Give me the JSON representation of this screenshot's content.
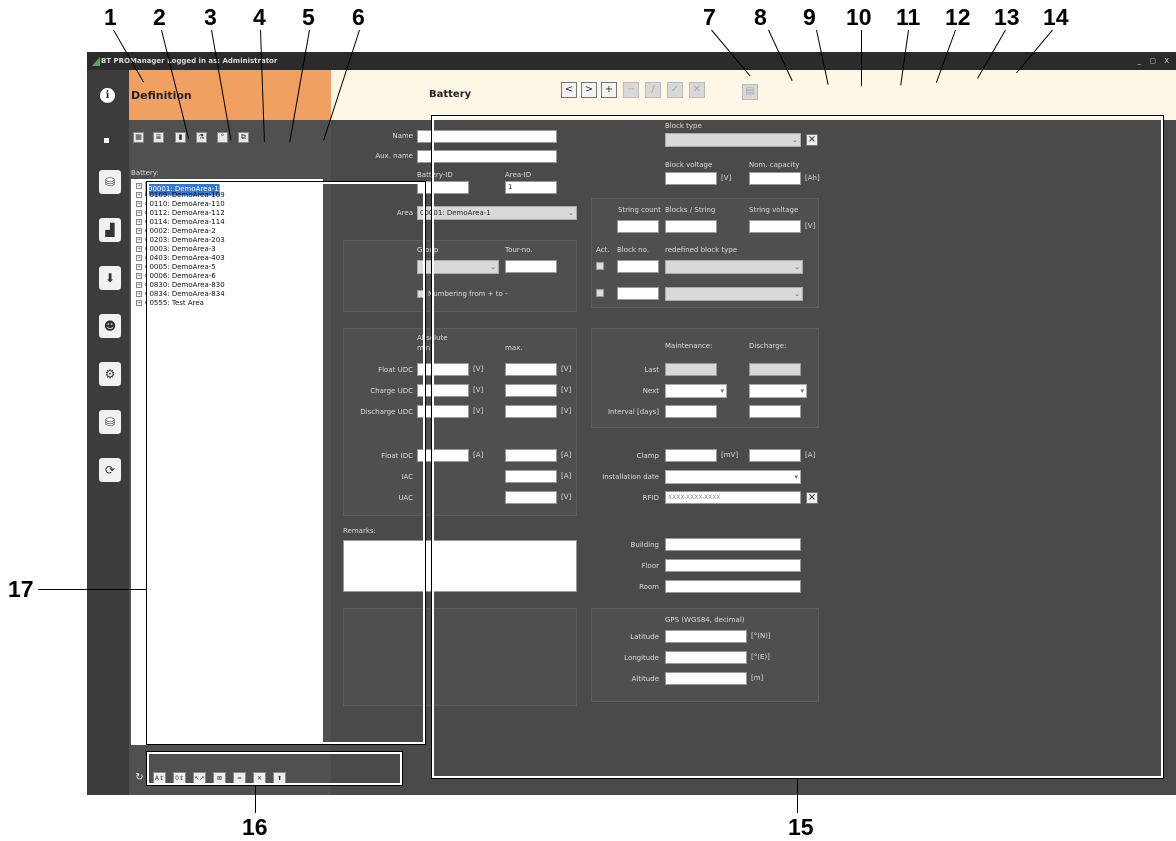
{
  "callouts": [
    "1",
    "2",
    "3",
    "4",
    "5",
    "6",
    "7",
    "8",
    "9",
    "10",
    "11",
    "12",
    "13",
    "14",
    "15",
    "16",
    "17"
  ],
  "window": {
    "app_name": "BT PRO",
    "title_text": "BT PROManager   Logged in as: Administrator",
    "controls": "_ ▢ X"
  },
  "info_icon": "i",
  "definition_tab": "Definition",
  "page_title": "Battery",
  "nav_buttons": [
    {
      "label": "<",
      "icon": "prev-icon",
      "enabled": true
    },
    {
      "label": ">",
      "icon": "next-icon",
      "enabled": true
    },
    {
      "label": "+",
      "icon": "add-icon",
      "enabled": true
    },
    {
      "label": "−",
      "icon": "delete-icon",
      "enabled": false
    },
    {
      "label": "/",
      "icon": "edit-icon",
      "enabled": false
    },
    {
      "label": "✓",
      "icon": "save-icon",
      "enabled": false
    },
    {
      "label": "✕",
      "icon": "cancel-icon",
      "enabled": false
    }
  ],
  "left_toolbar_icons": [
    "table-icon",
    "list-icon",
    "battery-icon",
    "flask-icon",
    "temperature-icon",
    "copy-icon"
  ],
  "battery_label": "Battery:",
  "tree_items": [
    "00001: DemoArea-1",
    "00109: DemoArea-109",
    "00110: DemoArea-110",
    "00112: DemoArea-112",
    "00114: DemoArea-114",
    "00002: DemoArea-2",
    "00203: DemoArea-203",
    "00003: DemoArea-3",
    "00403: DemoArea-403",
    "00005: DemoArea-5",
    "00006: DemoArea-6",
    "00830: DemoArea-830",
    "00834: DemoArea-834",
    "00555: Test Area"
  ],
  "bottom_buttons": [
    "A↕",
    "0↕",
    "↖↗",
    "⊠",
    "=",
    "✕",
    "⬆"
  ],
  "sidebar_icons": [
    "database-check-icon",
    "chart-icon",
    "download-icon",
    "users-icon",
    "settings-icon",
    "database-settings-icon",
    "sync-icon"
  ],
  "form": {
    "name": "Name",
    "aux_name": "Aux. name",
    "battery_id": "Battery-ID",
    "area_id": "Area-ID",
    "area_id_value": "1",
    "area": "Area",
    "area_value": "00001: DemoArea-1",
    "group": "Group",
    "tour_no": "Tour-no.",
    "numbering": "Numbering from + to -",
    "absolute": "Absolute",
    "min": "min.",
    "max": "max.",
    "float_udc": "Float UDC",
    "charge_udc": "Charge UDC",
    "discharge_udc": "Discharge UDC",
    "float_idc": "Float IDC",
    "iac": "IAC",
    "uac": "UAC",
    "unit_v": "[V]",
    "unit_a": "[A]",
    "unit_mv": "[mV]",
    "unit_ah": "[Ah]",
    "remarks": "Remarks:",
    "block_type": "Block type",
    "block_voltage": "Block voltage",
    "nom_capacity": "Nom. capacity",
    "string_count": "String count",
    "blocks_per_string": "Blocks / String",
    "string_voltage": "String voltage",
    "act": "Act.",
    "block_no": "Block no.",
    "redefined_block_type": "redefined block type",
    "maintenance": "Maintenance:",
    "discharge": "Discharge:",
    "last": "Last",
    "next": "Next",
    "interval": "Interval [days]",
    "clamp": "Clamp",
    "installation_date": "Installation date",
    "rfid": "RFID",
    "rfid_value": "XXXX-XXXX-XXXX",
    "building": "Building",
    "floor": "Floor",
    "room": "Room",
    "gps": "GPS (WGS84, decimal)",
    "latitude": "Latitude",
    "longitude": "Longitude",
    "altitude": "Altitude",
    "unit_n": "[°(N)]",
    "unit_e": "[°(E)]",
    "unit_m": "[m]"
  }
}
